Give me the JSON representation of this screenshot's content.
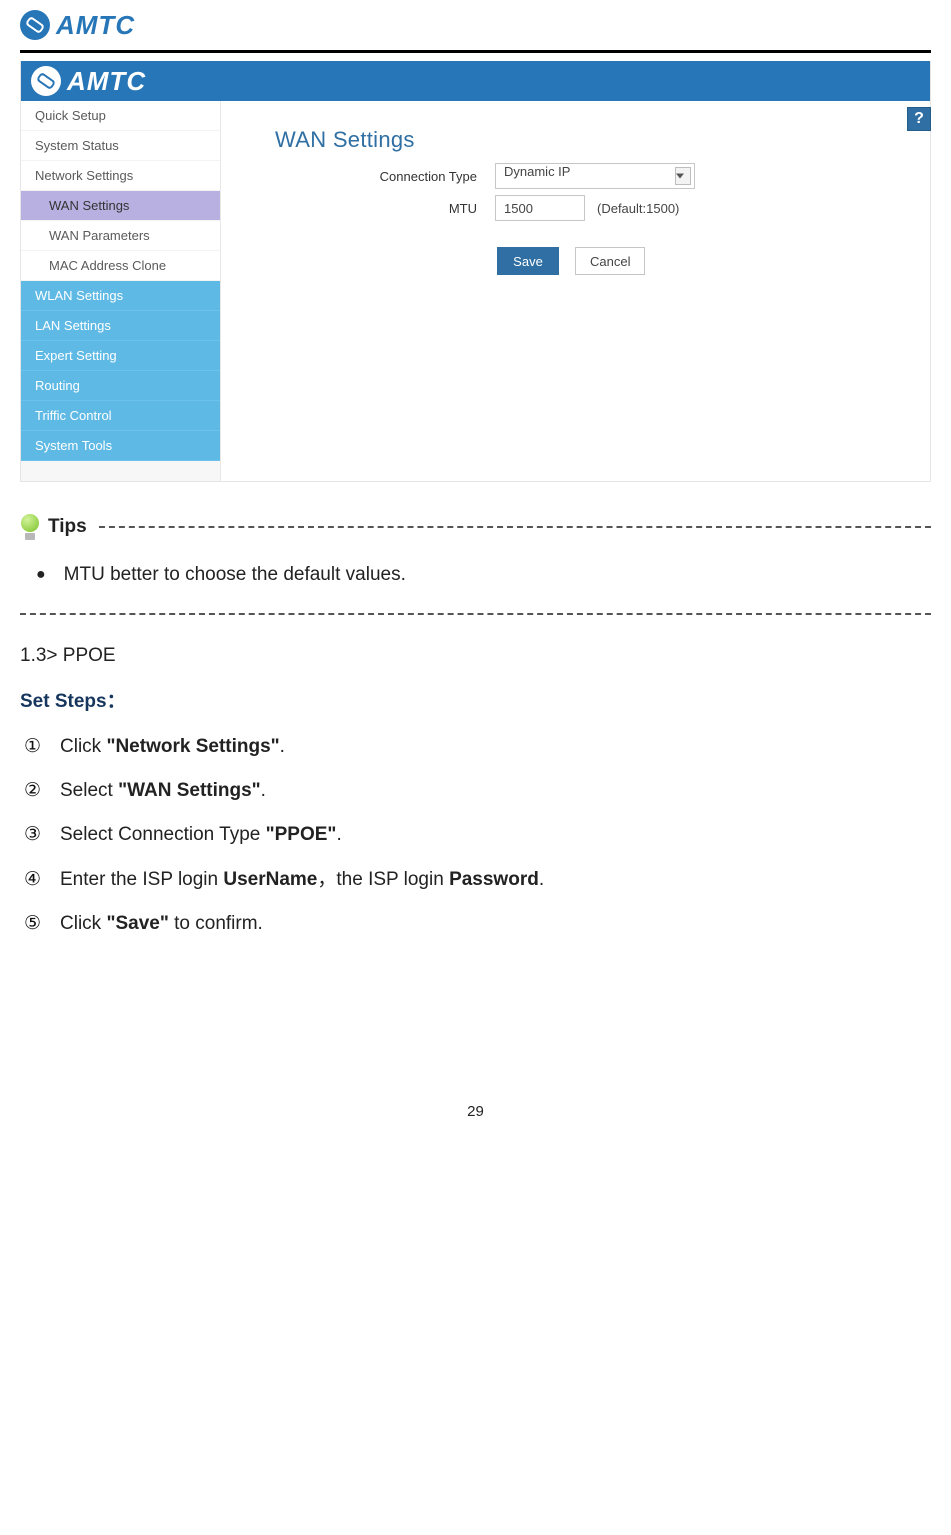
{
  "logo_text": "AMTC",
  "screenshot": {
    "sidebar": {
      "top": [
        {
          "label": "Quick Setup"
        },
        {
          "label": "System Status"
        },
        {
          "label": "Network Settings"
        }
      ],
      "subs": [
        {
          "label": "WAN Settings",
          "active": true
        },
        {
          "label": "WAN Parameters",
          "active": false
        },
        {
          "label": "MAC Address Clone",
          "active": false
        }
      ],
      "bottom": [
        {
          "label": "WLAN Settings"
        },
        {
          "label": "LAN Settings"
        },
        {
          "label": "Expert Setting"
        },
        {
          "label": "Routing"
        },
        {
          "label": "Triffic Control"
        },
        {
          "label": "System Tools"
        }
      ]
    },
    "main": {
      "help_glyph": "?",
      "title": "WAN Settings",
      "conn_label": "Connection Type",
      "conn_value": "Dynamic IP",
      "mtu_label": "MTU",
      "mtu_value": "1500",
      "mtu_hint": "(Default:1500)",
      "save_label": "Save",
      "cancel_label": "Cancel"
    }
  },
  "doc": {
    "tips_label": "Tips",
    "tip_bullet": "MTU better to choose the default values.",
    "section_1_3": "1.3> PPOE",
    "set_steps": "Set Steps：",
    "steps": {
      "s1": {
        "num": "①",
        "pre": "Click ",
        "bold": "\"Network Settings\"",
        "post": "."
      },
      "s2": {
        "num": "②",
        "pre": "Select ",
        "bold": "\"WAN Settings\"",
        "post": "."
      },
      "s3": {
        "num": "③",
        "pre": "Select Connection Type ",
        "bold": "\"PPOE\"",
        "post": "."
      },
      "s4": {
        "num": "④",
        "pre": "Enter the ISP login ",
        "bold1": "UserName",
        "mid": "，the ISP login ",
        "bold2": "Password",
        "post": "."
      },
      "s5": {
        "num": "⑤",
        "pre": "Click ",
        "bold": "\"Save\"",
        "post": " to confirm."
      }
    },
    "page_number": "29"
  }
}
